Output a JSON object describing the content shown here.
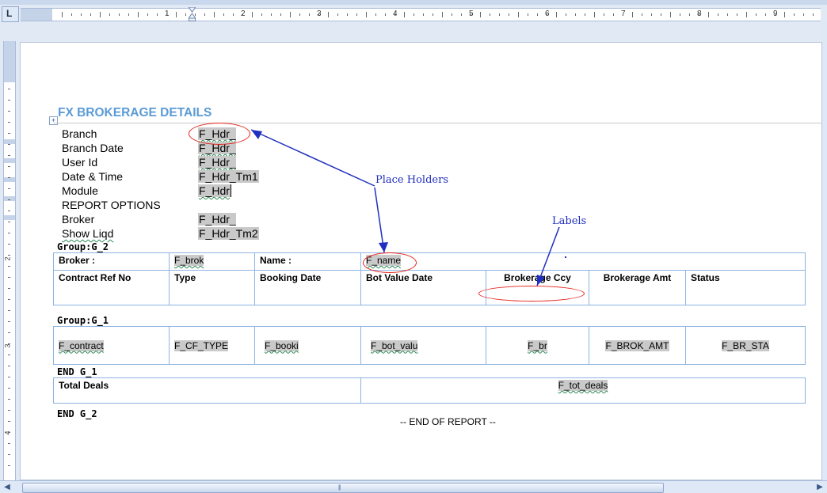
{
  "ruler": {
    "corner": "L",
    "numbers": [
      "1",
      "2",
      "3",
      "4",
      "5",
      "6",
      "7",
      "8",
      "9"
    ],
    "vertical_numbers": [
      "2",
      "3",
      "4"
    ]
  },
  "report": {
    "title": "FX BROKERAGE DETAILS",
    "header_fields": [
      {
        "label": "Branch",
        "value": "F_Hdr_"
      },
      {
        "label": "Branch Date",
        "value": "F_Hdr_"
      },
      {
        "label": "User Id",
        "value": "F_Hdr_"
      },
      {
        "label": "Date & Time",
        "value": "F_Hdr_Tm1"
      },
      {
        "label": "Module",
        "value": "F_Hdr"
      },
      {
        "label": "REPORT OPTIONS",
        "value": ""
      },
      {
        "label": "Broker",
        "value": "F_Hdr_"
      },
      {
        "label": "Show Liqd",
        "value": "F_Hdr_Tm2"
      }
    ],
    "group_g2_start": "Group:G_2",
    "broker_row": {
      "broker_label": "Broker :",
      "broker_field": "F_brok",
      "name_label": "Name :",
      "name_field": "F_name"
    },
    "columns": [
      "Contract Ref No",
      "Type",
      "Booking Date",
      "Bot Value Date",
      "Brokerage  Ccy",
      "Brokerage Amt",
      "Status"
    ],
    "group_g1_start": "Group:G_1",
    "detail_row": [
      "F_contract",
      "F_CF_TYPE",
      "F_booki",
      "F_bot_valu",
      "F_br",
      "F_BROK_AMT",
      "F_BR_STA"
    ],
    "group_g1_end": "END G_1",
    "total_label": "Total Deals",
    "total_field": "F_tot_deals",
    "group_g2_end": "END G_2",
    "end_text": "-- END OF REPORT --"
  },
  "annotations": {
    "place_holders": "Place Holders",
    "labels": "Labels",
    "arrow_color": "#1f2fbf",
    "oval_color": "#e2231a"
  },
  "colors": {
    "title": "#5b9bd5",
    "table_border": "#8db3e2",
    "field_shade": "#c9c9c9",
    "chrome": "#e1e9f5"
  }
}
